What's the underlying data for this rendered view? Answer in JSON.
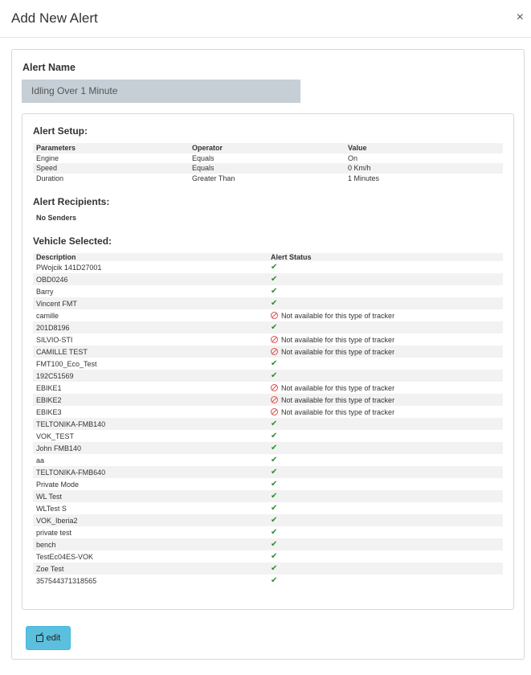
{
  "modal": {
    "title": "Add New Alert",
    "close_symbol": "×"
  },
  "alert_name": {
    "label": "Alert Name",
    "value": "Idling Over 1 Minute"
  },
  "alert_setup": {
    "title": "Alert Setup:",
    "headers": [
      "Parameters",
      "Operator",
      "Value"
    ],
    "rows": [
      [
        "Engine",
        "Equals",
        "On"
      ],
      [
        "Speed",
        "Equals",
        "0 Km/h"
      ],
      [
        "Duration",
        "Greater Than",
        "1 Minutes"
      ]
    ]
  },
  "alert_recipients": {
    "title": "Alert Recipients:",
    "value": "No Senders"
  },
  "vehicles": {
    "title": "Vehicle Selected:",
    "headers": [
      "Description",
      "Alert Status"
    ],
    "na_text": "Not available for this type of tracker",
    "ok_symbol": "✔",
    "rows": [
      {
        "name": "PWojcik 141D27001",
        "status": "ok"
      },
      {
        "name": "OBD0246",
        "status": "ok"
      },
      {
        "name": "Barry",
        "status": "ok"
      },
      {
        "name": "Vincent FMT",
        "status": "ok"
      },
      {
        "name": "camille",
        "status": "na"
      },
      {
        "name": "201D8196",
        "status": "ok"
      },
      {
        "name": "SILVIO-STI",
        "status": "na"
      },
      {
        "name": "CAMILLE TEST",
        "status": "na"
      },
      {
        "name": "FMT100_Eco_Test",
        "status": "ok"
      },
      {
        "name": "192C51569",
        "status": "ok"
      },
      {
        "name": "EBIKE1",
        "status": "na"
      },
      {
        "name": "EBIKE2",
        "status": "na"
      },
      {
        "name": "EBIKE3",
        "status": "na"
      },
      {
        "name": "TELTONIKA-FMB140",
        "status": "ok"
      },
      {
        "name": "VOK_TEST",
        "status": "ok"
      },
      {
        "name": "John FMB140",
        "status": "ok"
      },
      {
        "name": "aa",
        "status": "ok"
      },
      {
        "name": "TELTONIKA-FMB640",
        "status": "ok"
      },
      {
        "name": "Private Mode",
        "status": "ok"
      },
      {
        "name": "WL Test",
        "status": "ok"
      },
      {
        "name": "WLTest S",
        "status": "ok"
      },
      {
        "name": "VOK_Iberia2",
        "status": "ok"
      },
      {
        "name": "private test",
        "status": "ok"
      },
      {
        "name": "bench",
        "status": "ok"
      },
      {
        "name": "TestEc04ES-VOK",
        "status": "ok"
      },
      {
        "name": "Zoe Test",
        "status": "ok"
      },
      {
        "name": "357544371318565",
        "status": "ok"
      }
    ]
  },
  "edit_button": {
    "label": "edit",
    "icon": "edit-icon"
  },
  "colors": {
    "input_bg": "#c6cfd6",
    "button_bg": "#5bc0de",
    "ok_green": "#2e8b2e",
    "na_red": "#d9534f"
  }
}
